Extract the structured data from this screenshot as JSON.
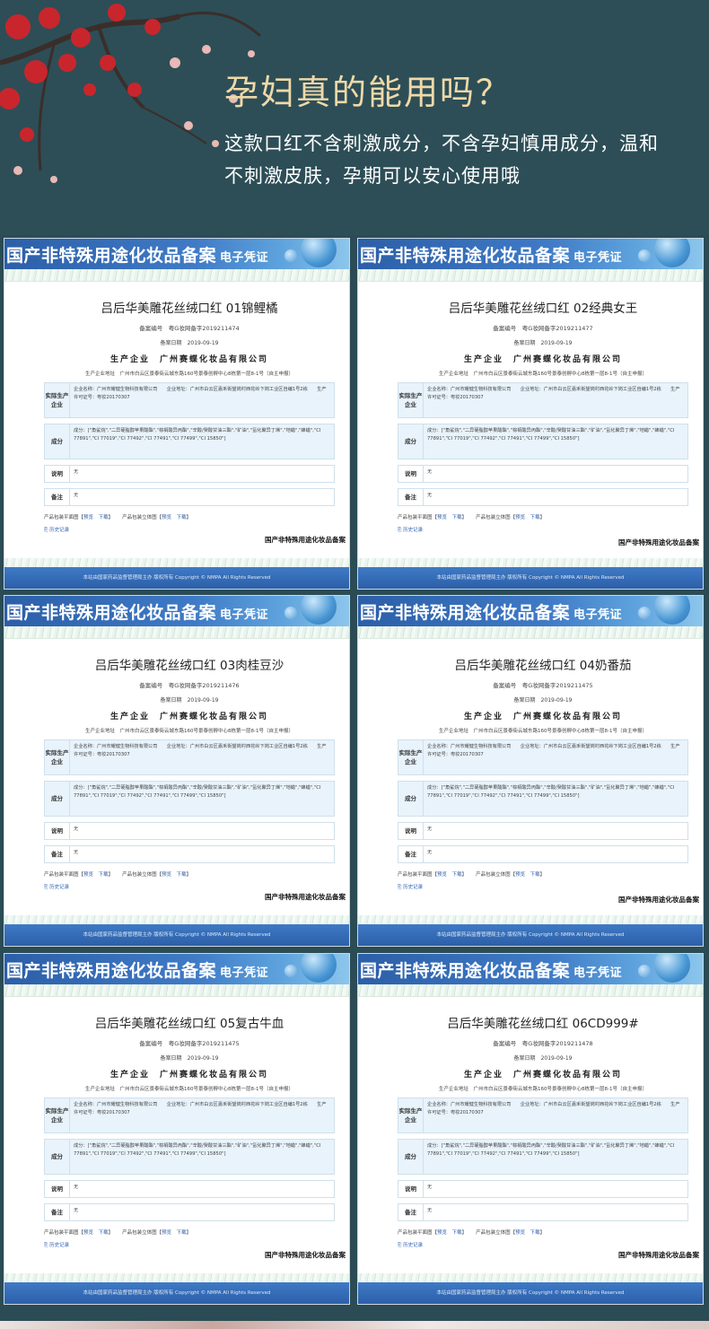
{
  "hero": {
    "title": "孕妇真的能用吗？",
    "line1": "这款口红不含刺激成分，不含孕妇慎用成分，温和",
    "line2": "不刺激皮肤，孕期可以安心使用哦"
  },
  "certificate_common": {
    "banner": "国产非特殊用途化妆品备案",
    "banner_sub": "电子凭证",
    "date_label": "备案日期",
    "date": "2019-09-19",
    "company": "生产企业　广州赛蝶化妆品有限公司",
    "address": "生产企业地址　广州市白云区景泰街云城东路160号景泰创孵中心8栋第一层8-1号（自主申报）",
    "mfr_label": "实际生产企业",
    "mfr_text": "企业名称：广州市耀健生物科技有限公司　　企业地址：广州市白云区嘉禾街望岗村西花岭下岗工业区自编1号2栋　　生产许可证号：粤妆20170307",
    "ing_label": "成分",
    "ing_text": "成分：[\"角鲨烷\",\"二异硬脂醇苹果酸酯\",\"棕榈酸异丙酯\",\"辛酸/癸酸甘油三酯\",\"矿油\",\"氢化聚异丁烯\",\"地蜡\",\"蜂蜡\",\"CI 77891\",\"CI 77019\",\"CI 77492\",\"CI 77491\",\"CI 77499\",\"CI 15850\"]",
    "note_label": "说明",
    "note_value": "无",
    "remark_label": "备注",
    "remark_value": "无",
    "pkg_flat": "产品包装平面图",
    "pkg_3d": "产品包装立体图",
    "preview": "预览",
    "download": "下载",
    "history": "历史记录",
    "seal": "国产非特殊用途化妆品备案",
    "footer": "本站由国家药品监督管理局主办 版权所有 Copyright © NMPA All Rights Reserved"
  },
  "certificates": [
    {
      "title": "吕后华美雕花丝绒口红 01锦鲤橘",
      "record": "备案编号　粤G妆网备字2019211474"
    },
    {
      "title": "吕后华美雕花丝绒口红 02经典女王",
      "record": "备案编号　粤G妆网备字2019211477"
    },
    {
      "title": "吕后华美雕花丝绒口红 03肉桂豆沙",
      "record": "备案编号　粤G妆网备字2019211476"
    },
    {
      "title": "吕后华美雕花丝绒口红 04奶番茄",
      "record": "备案编号　粤G妆网备字2019211475"
    },
    {
      "title": "吕后华美雕花丝绒口红 05复古牛血",
      "record": "备案编号　粤G妆网备字2019211475"
    },
    {
      "title": "吕后华美雕花丝绒口红 06CD999#",
      "record": "备案编号　粤G妆网备字2019211478"
    }
  ]
}
